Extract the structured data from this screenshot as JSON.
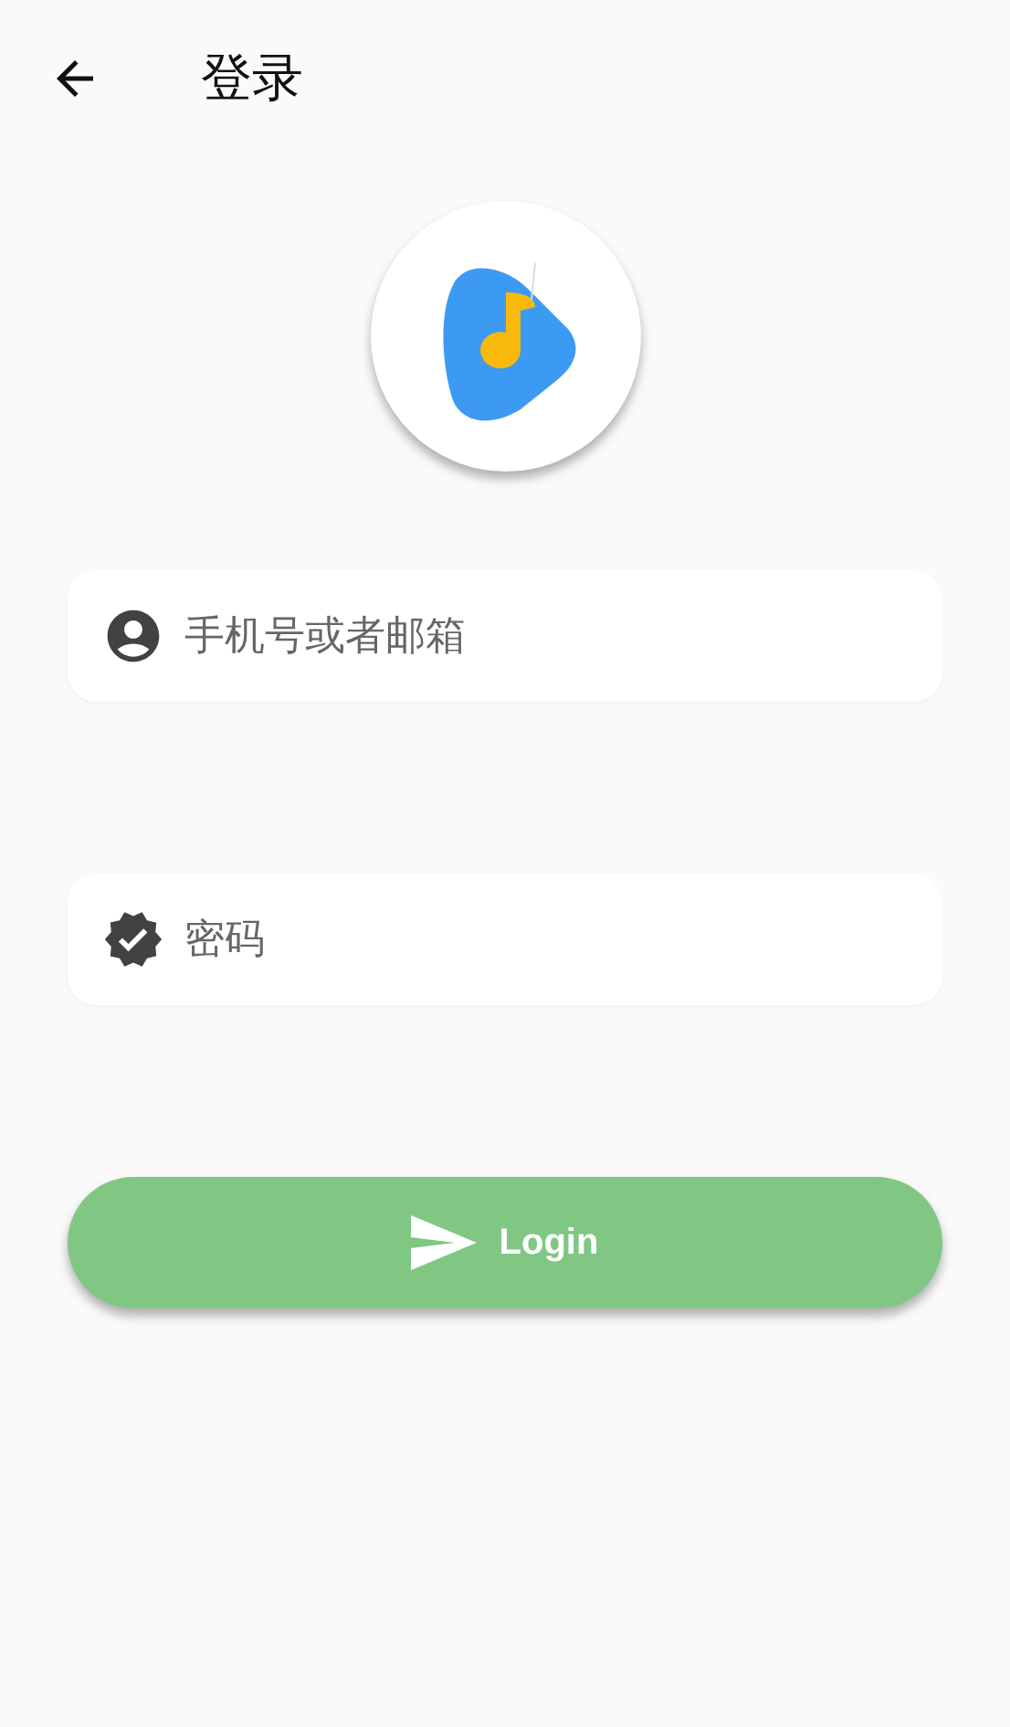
{
  "app_bar": {
    "title": "登录"
  },
  "fields": [
    {
      "kind": "account",
      "placeholder": "手机号或者邮箱"
    },
    {
      "kind": "password",
      "placeholder": "密码"
    }
  ],
  "login_button": {
    "label": "Login"
  }
}
